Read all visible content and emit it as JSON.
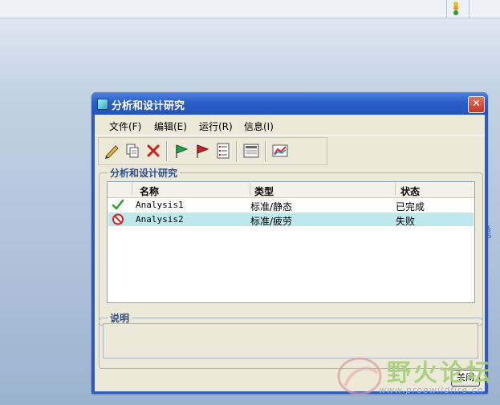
{
  "dialog": {
    "title": "分析和设计研究",
    "close_glyph": "✕",
    "menu": [
      {
        "label": "文件(F)"
      },
      {
        "label": "编辑(E)"
      },
      {
        "label": "运行(R)"
      },
      {
        "label": "信息(I)"
      }
    ],
    "toolbar": [
      {
        "icon": "pencil-icon"
      },
      {
        "icon": "copy-icon"
      },
      {
        "icon": "delete-icon"
      },
      {
        "icon": "green-flag-icon"
      },
      {
        "icon": "red-flag-icon"
      },
      {
        "icon": "list-icon"
      },
      {
        "icon": "report-icon"
      },
      {
        "icon": "graph-icon"
      }
    ],
    "studies_group": {
      "label": "分析和设计研究",
      "columns": [
        "名称",
        "类型",
        "状态"
      ],
      "rows": [
        {
          "status_icon": "check-icon",
          "name": "Analysis1",
          "type": "标准/静态",
          "status": "已完成",
          "selected": false
        },
        {
          "status_icon": "prohibited-icon",
          "name": "Analysis2",
          "type": "标准/疲劳",
          "status": "失败",
          "selected": true
        }
      ]
    },
    "description_group": {
      "label": "说明",
      "value": ""
    },
    "close_button_label": "关闭"
  },
  "watermark": {
    "text": "野火论坛",
    "url": "www.proewildfire.cn"
  },
  "colors": {
    "titlebar": "#2a5ec8",
    "selected_row": "#bde8ed",
    "group_label": "#2a4e8c",
    "check": "#2aa02a",
    "prohibited": "#d42424"
  }
}
